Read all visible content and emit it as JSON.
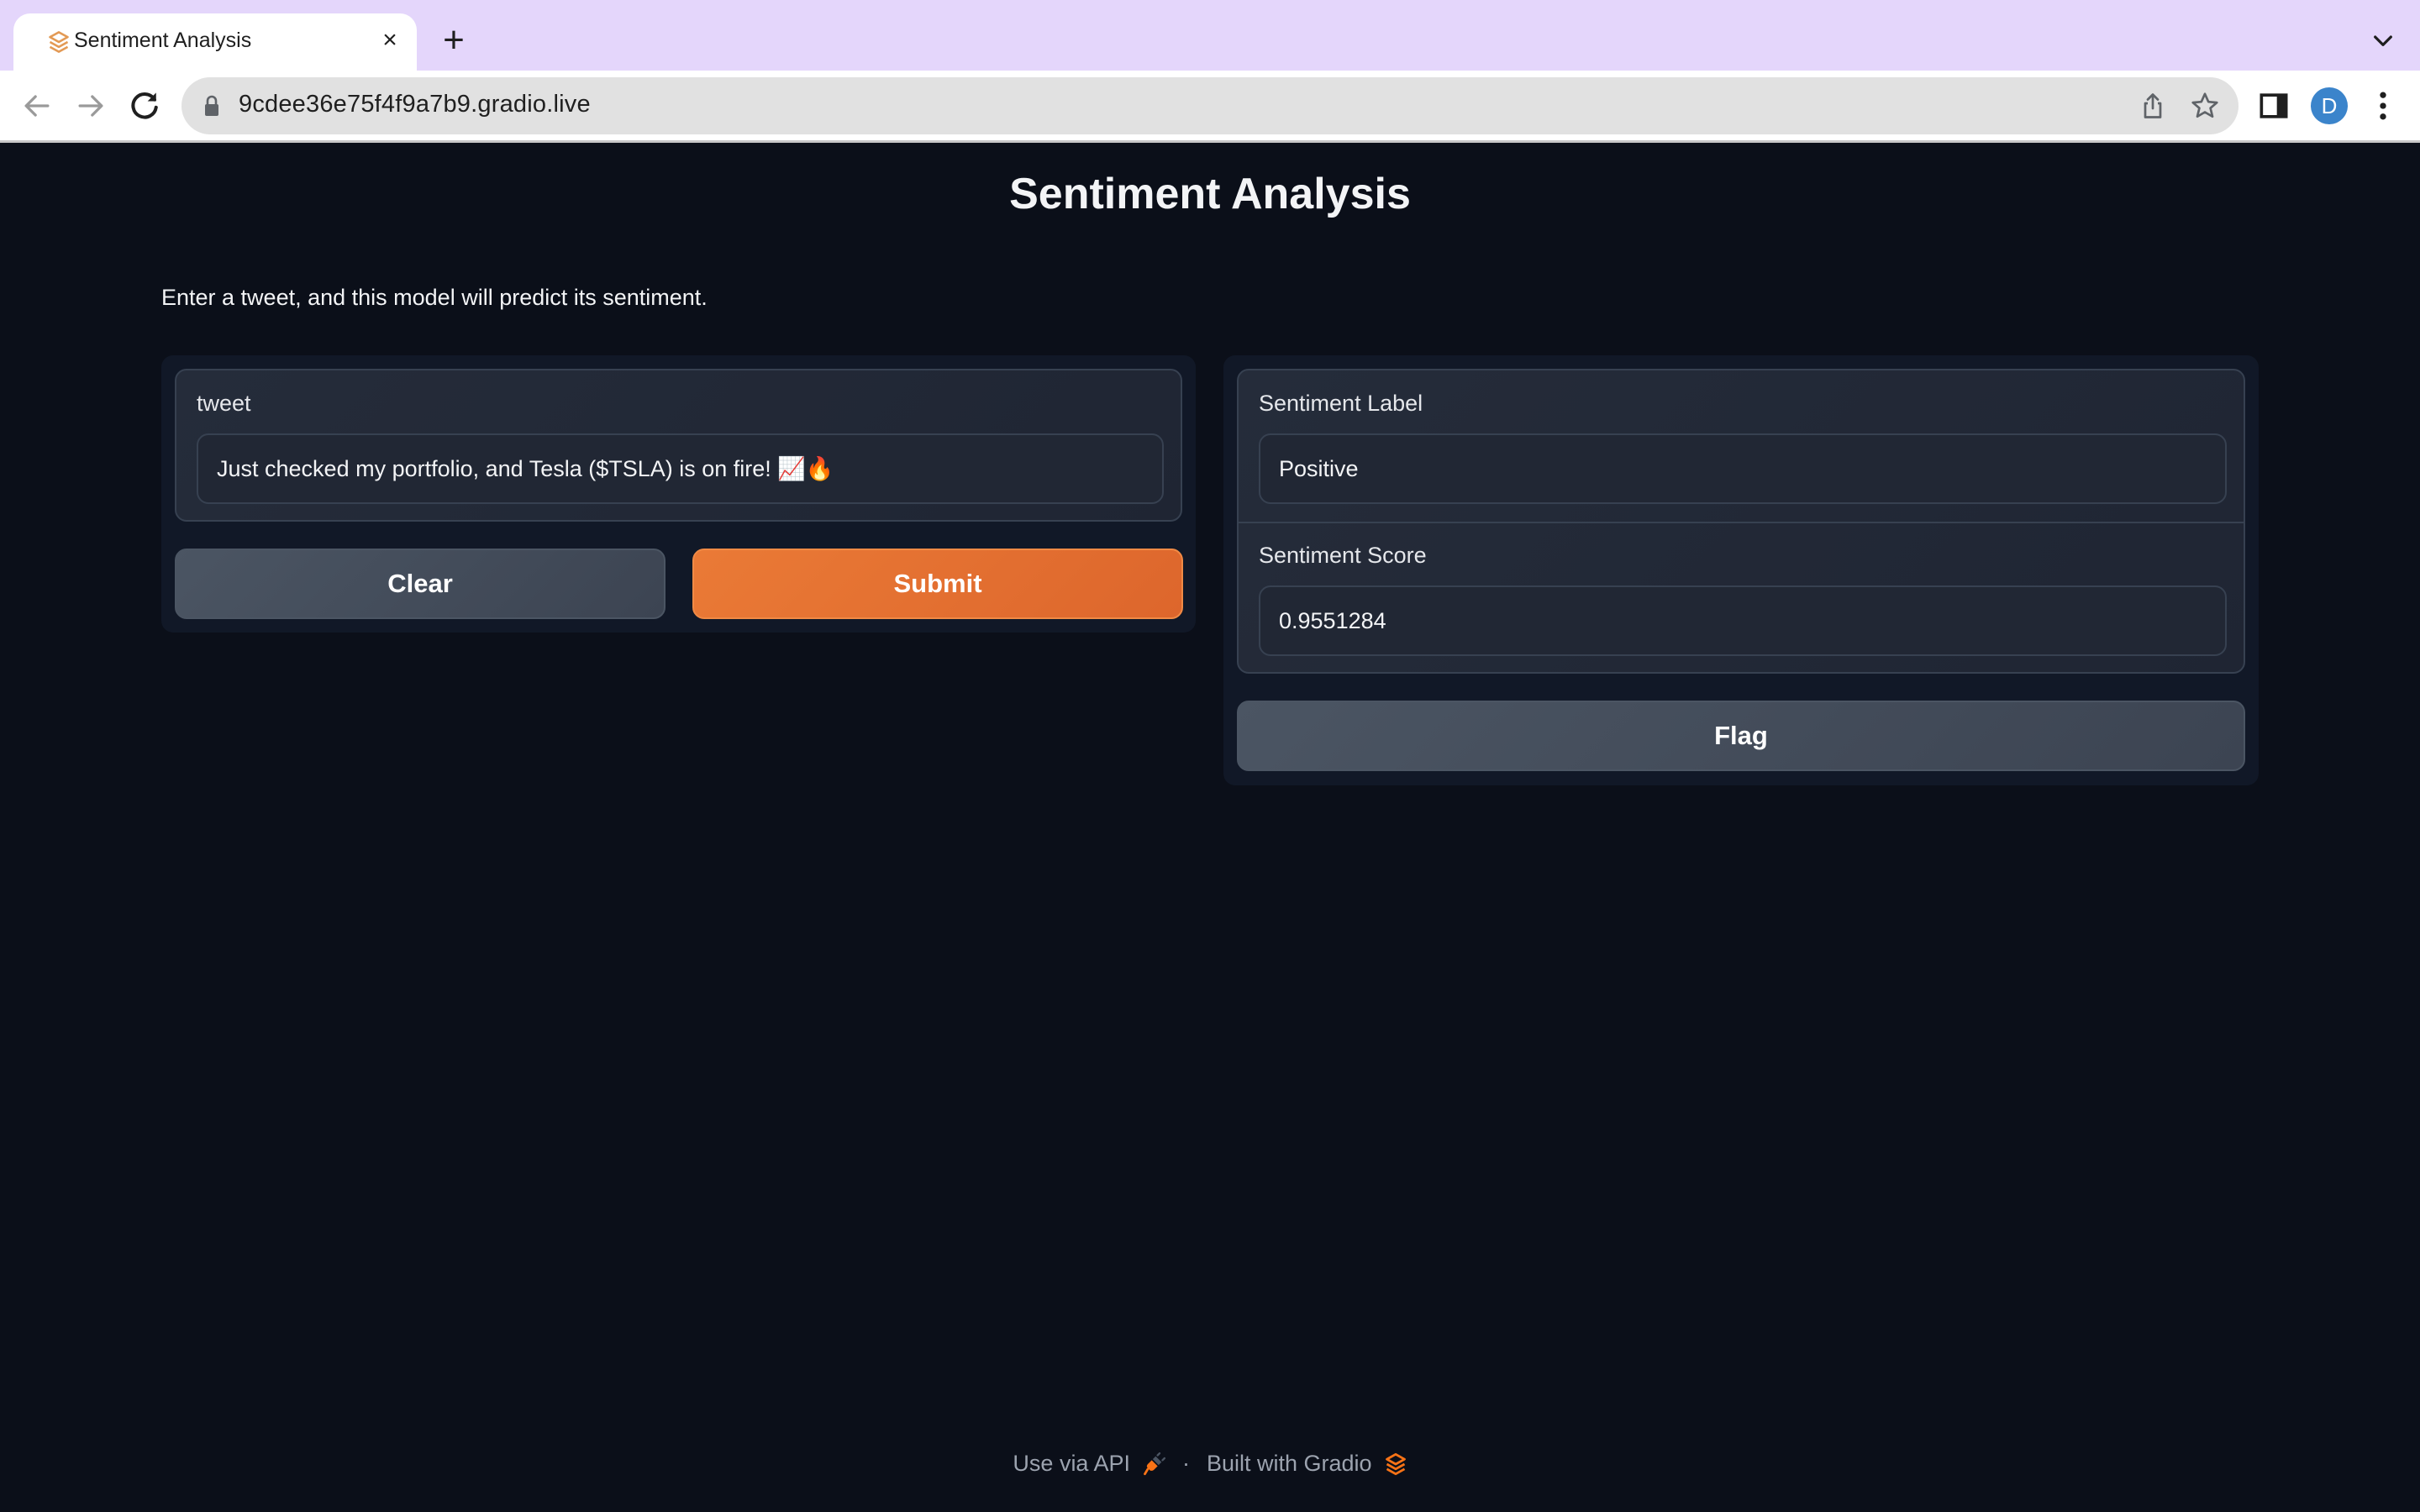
{
  "browser": {
    "tab_title": "Sentiment Analysis",
    "url": "9cdee36e75f4f9a7b9.gradio.live",
    "profile_initial": "D",
    "icons": {
      "favicon": "gradio-logo-icon",
      "tab_close": "close-icon",
      "new_tab": "plus-icon",
      "tab_list": "chevron-down-icon",
      "back": "arrow-left-icon",
      "forward": "arrow-right-icon",
      "reload": "reload-icon",
      "lock": "lock-icon",
      "share": "share-icon",
      "bookmark": "star-icon",
      "side_panel": "side-panel-icon",
      "menu": "kebab-menu-icon"
    },
    "tab_close_glyph": "×",
    "new_tab_glyph": "+"
  },
  "app": {
    "title": "Sentiment Analysis",
    "description": "Enter a tweet, and this model will predict its sentiment.",
    "colors": {
      "background": "#0b0f19",
      "panel": "#111827",
      "primary": "#e8732f",
      "secondary": "#4b5563"
    },
    "inputs": {
      "tweet": {
        "label": "tweet",
        "value": "Just checked my portfolio, and Tesla ($TSLA) is on fire! 📈🔥"
      }
    },
    "buttons": {
      "clear": "Clear",
      "submit": "Submit",
      "flag": "Flag"
    },
    "outputs": {
      "sentiment_label": {
        "label": "Sentiment Label",
        "value": "Positive"
      },
      "sentiment_score": {
        "label": "Sentiment Score",
        "value": "0.9551284"
      }
    },
    "footer": {
      "api_link": "Use via API",
      "separator": "·",
      "built_with": "Built with Gradio"
    }
  }
}
